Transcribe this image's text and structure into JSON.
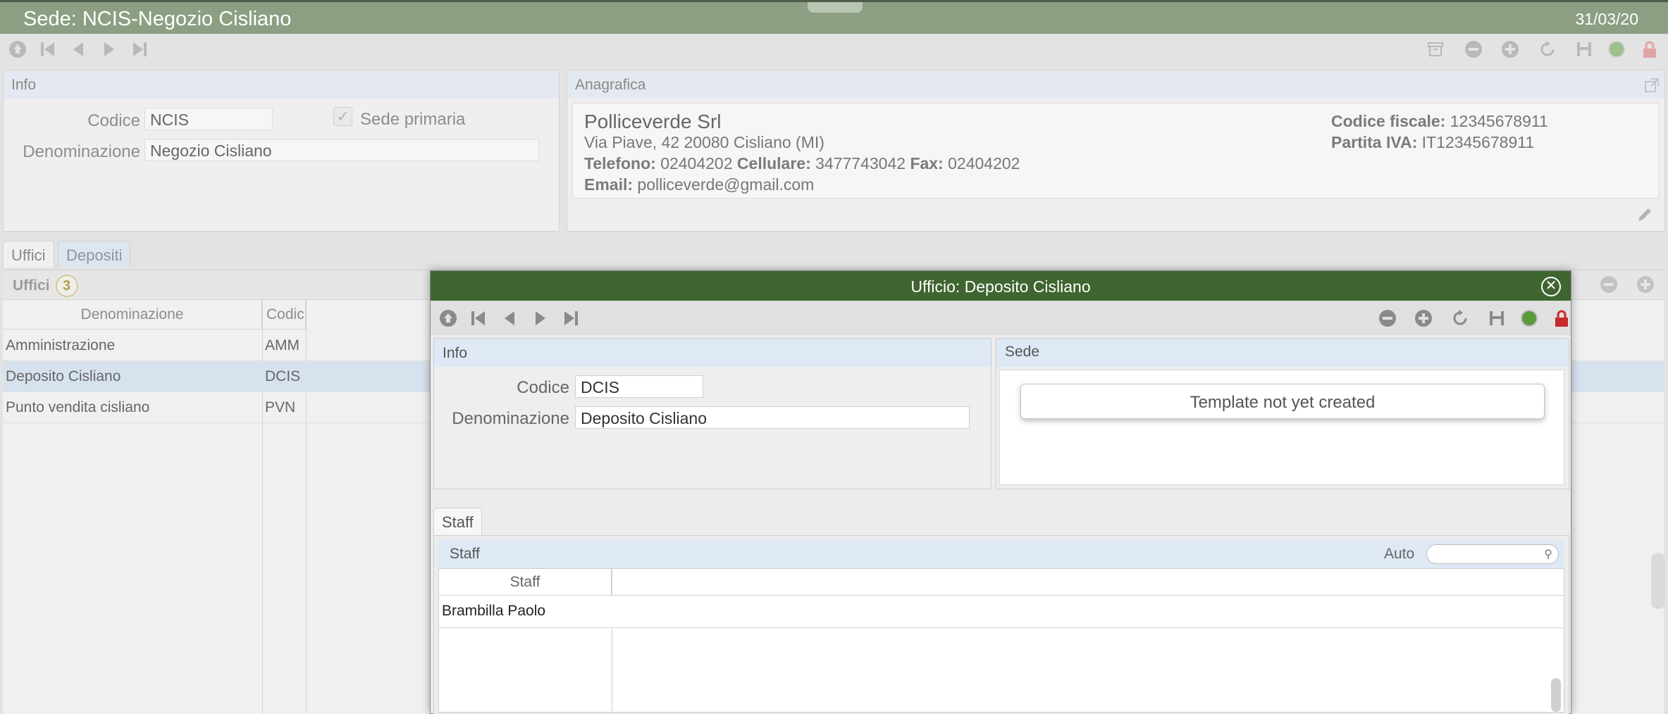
{
  "window": {
    "title": "Sede: NCIS-Negozio Cisliano",
    "date": "31/03/20"
  },
  "main_toolbar": {
    "left_icons": [
      "home-icon",
      "first-record-icon",
      "previous-record-icon",
      "next-record-icon",
      "last-record-icon"
    ],
    "right_icons": [
      "archive-icon",
      "delete-icon",
      "add-icon",
      "reload-icon",
      "save-icon",
      "status-icon",
      "lock-icon"
    ]
  },
  "info_panel": {
    "title": "Info",
    "codice_label": "Codice",
    "codice_value": "NCIS",
    "sede_primaria_label": "Sede primaria",
    "denominazione_label": "Denominazione",
    "denominazione_value": "Negozio Cisliano"
  },
  "anagrafica_panel": {
    "title": "Anagrafica",
    "company": "Polliceverde Srl",
    "address": "Via Piave, 42 20080 Cisliano (MI)",
    "telefono_label": "Telefono:",
    "telefono": "02404202",
    "cellulare_label": "Cellulare:",
    "cellulare": "3477743042",
    "fax_label": "Fax:",
    "fax": "02404202",
    "email_label": "Email:",
    "email": "polliceverde@gmail.com",
    "codice_fiscale_label": "Codice fiscale:",
    "codice_fiscale": "12345678911",
    "partita_iva_label": "Partita IVA:",
    "partita_iva": "IT12345678911"
  },
  "tabs": [
    {
      "label": "Uffici",
      "active": true
    },
    {
      "label": "Depositi",
      "active": false
    }
  ],
  "uffici": {
    "title": "Uffici",
    "count": "3",
    "columns": [
      "Denominazione",
      "Codic"
    ],
    "rows": [
      {
        "denominazione": "Amministrazione",
        "codice": "AMM"
      },
      {
        "denominazione": "Deposito Cisliano",
        "codice": "DCIS"
      },
      {
        "denominazione": "Punto vendita cisliano",
        "codice": "PVN"
      }
    ]
  },
  "dialog": {
    "title": "Ufficio: Deposito Cisliano",
    "info": {
      "title": "Info",
      "codice_label": "Codice",
      "codice_value": "DCIS",
      "denominazione_label": "Denominazione",
      "denominazione_value": "Deposito Cisliano"
    },
    "sede": {
      "title": "Sede",
      "template_message": "Template not yet created"
    },
    "staff_tab": "Staff",
    "staff": {
      "title": "Staff",
      "auto_label": "Auto",
      "search_value": "",
      "column": "Staff",
      "rows": [
        "Brambilla Paolo"
      ]
    }
  },
  "colors": {
    "title_bar": "#8c9f82",
    "dialog_title_bar": "#3f6530",
    "selected_row": "#d7e2ef",
    "panel_header": "#e4e9f1"
  }
}
